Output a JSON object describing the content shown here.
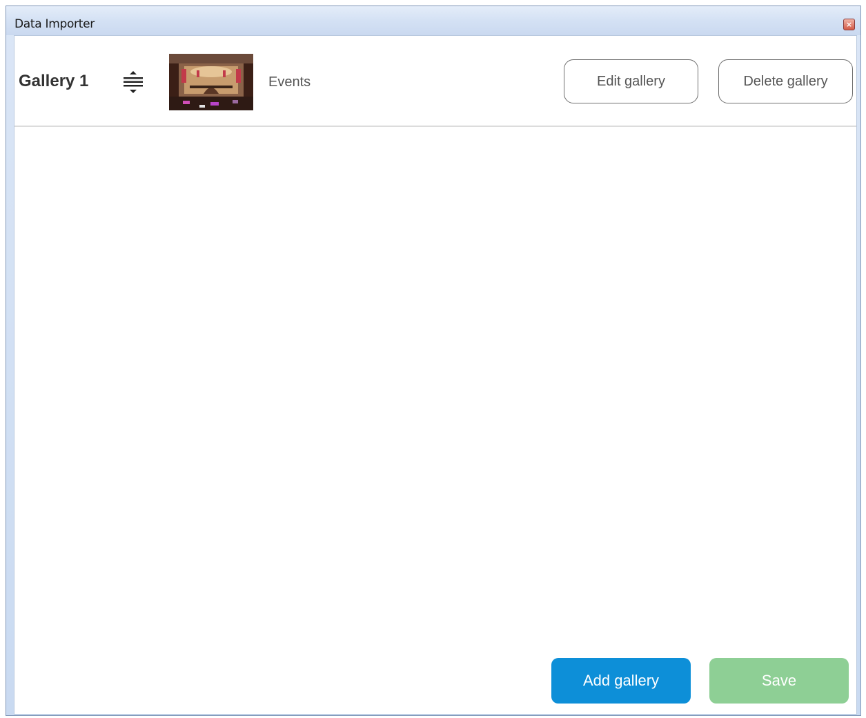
{
  "window": {
    "title": "Data Importer",
    "close_glyph": "×"
  },
  "gallery": {
    "name": "Gallery 1",
    "drag_icon": "drag-handle-icon",
    "thumbnail": "gallery-thumbnail-image",
    "category": "Events"
  },
  "actions": {
    "edit_label": "Edit gallery",
    "delete_label": "Delete gallery",
    "add_label": "Add gallery",
    "save_label": "Save"
  },
  "colors": {
    "add_button": "#0d8fd8",
    "save_button": "#8ecf95",
    "title_bar": "#d4e1f4"
  }
}
